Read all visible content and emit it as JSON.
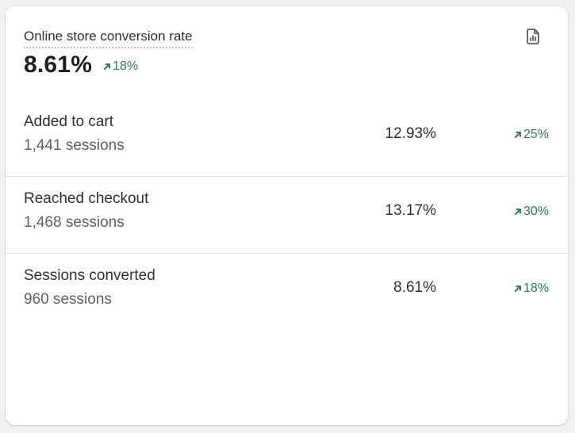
{
  "card": {
    "title": "Online store conversion rate",
    "value": "8.61%",
    "change": "18%",
    "export_icon": "report-document-icon",
    "positive_color": "#2e7a5a"
  },
  "rows": [
    {
      "label": "Added to cart",
      "sessions": "1,441 sessions",
      "rate": "12.93%",
      "change": "25%"
    },
    {
      "label": "Reached checkout",
      "sessions": "1,468 sessions",
      "rate": "13.17%",
      "change": "30%"
    },
    {
      "label": "Sessions converted",
      "sessions": "960 sessions",
      "rate": "8.61%",
      "change": "18%"
    }
  ]
}
